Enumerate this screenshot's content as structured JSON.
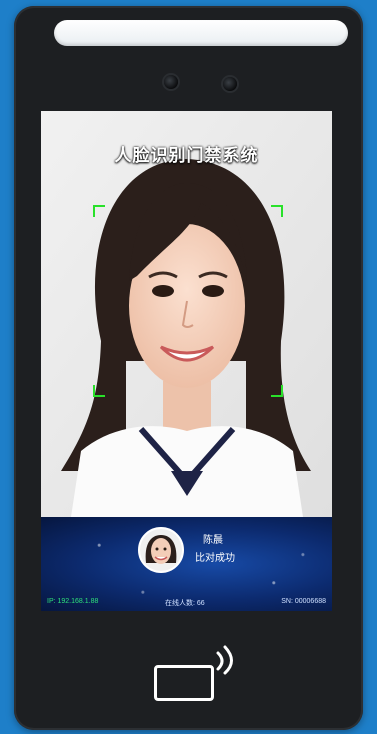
{
  "app": {
    "title": "人脸识别门禁系统"
  },
  "panel": {
    "person_name": "陈晨",
    "status": "比对成功",
    "ip": "IP: 192.168.1.88",
    "online_count": "在线人数: 66",
    "serial": "SN: 00006688"
  },
  "icons": {
    "nfc": "nfc-reader-icon",
    "camera": "camera-icon"
  },
  "colors": {
    "device": "#1d1f22",
    "background": "#1e7fc9",
    "frame_corner": "#29e12a",
    "panel_bg": "#0c2a6e"
  }
}
